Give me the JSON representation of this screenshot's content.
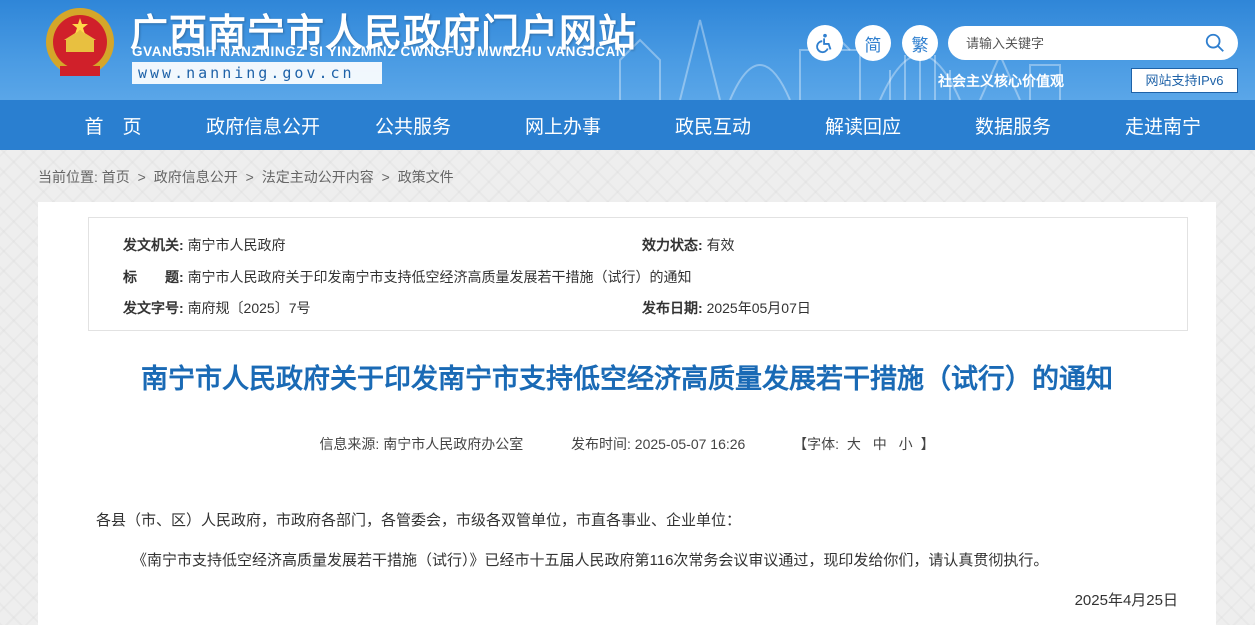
{
  "header": {
    "site_title": "广西南宁市人民政府门户网站",
    "site_pinyin": "GVANGJSIH NANZNINGZ SI YINZMINZ CWNGFUJ MWNZHU VANGJCAN",
    "site_url": "www.nanning.gov.cn",
    "accessibility_icon": "wheelchair-icon",
    "simplified_label": "简",
    "traditional_label": "繁",
    "search_placeholder": "请输入关键字",
    "search_icon": "magnifier-icon",
    "core_values_label": "社会主义核心价值观",
    "ipv6_label": "网站支持IPv6"
  },
  "nav": {
    "items": [
      "首　页",
      "政府信息公开",
      "公共服务",
      "网上办事",
      "政民互动",
      "解读回应",
      "数据服务",
      "走进南宁"
    ]
  },
  "breadcrumb": {
    "prefix": "当前位置:",
    "items": [
      "首页",
      "政府信息公开",
      "法定主动公开内容",
      "政策文件"
    ],
    "separator": ">"
  },
  "meta": {
    "issuer_label": "发文机关:",
    "issuer_value": "南宁市人民政府",
    "status_label": "效力状态:",
    "status_value": "有效",
    "title_label": "标　　题:",
    "title_value": "南宁市人民政府关于印发南宁市支持低空经济高质量发展若干措施（试行）的通知",
    "docno_label": "发文字号:",
    "docno_value": "南府规〔2025〕7号",
    "date_label": "发布日期:",
    "date_value": "2025年05月07日"
  },
  "article": {
    "title": "南宁市人民政府关于印发南宁市支持低空经济高质量发展若干措施（试行）的通知",
    "source_label": "信息来源:",
    "source_value": "南宁市人民政府办公室",
    "time_label": "发布时间:",
    "time_value": "2025-05-07 16:26",
    "font_label_open": "【字体:",
    "font_large": "大",
    "font_medium": "中",
    "font_small": "小",
    "font_label_close": "】",
    "salutation": "各县（市、区）人民政府，市政府各部门，各管委会，市级各双管单位，市直各事业、企业单位：",
    "paragraph1": "《南宁市支持低空经济高质量发展若干措施（试行）》已经市十五届人民政府第116次常务会议审议通过，现印发给你们，请认真贯彻执行。",
    "sign_date": "2025年4月25日"
  },
  "colors": {
    "header_blue": "#2f86d8",
    "nav_blue": "#2a7fd0",
    "title_blue": "#1a6ab5"
  }
}
